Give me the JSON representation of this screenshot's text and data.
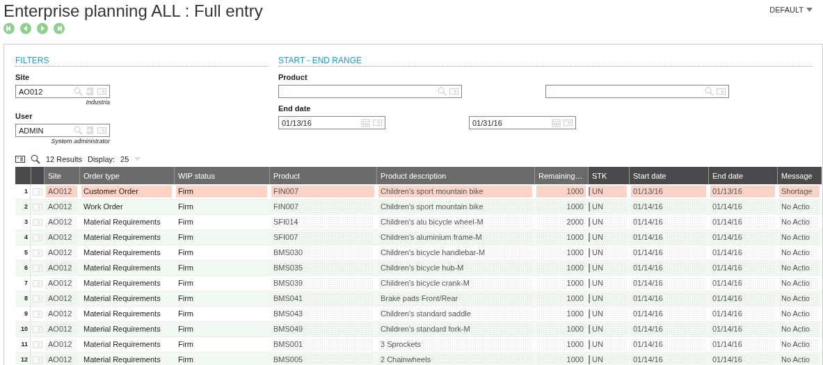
{
  "title": "Enterprise planning ALL : Full entry",
  "view_menu": "DEFAULT",
  "filters": {
    "heading": "FILTERS",
    "fields": [
      {
        "label": "Site",
        "value": "AO012",
        "caption": "Industria",
        "kind": "lookup_link"
      },
      {
        "label": "User",
        "value": "ADMIN",
        "caption": "System administrator",
        "kind": "lookup_link"
      }
    ]
  },
  "range": {
    "heading": "START - END RANGE",
    "rows": [
      {
        "label": "Product",
        "kind": "lookup",
        "from": {},
        "to": {}
      },
      {
        "label": "End date",
        "kind": "date",
        "from": {
          "value": "01/13/16"
        },
        "to": {
          "value": "01/31/16"
        }
      }
    ]
  },
  "toolbar": {
    "results": "12 Results",
    "display_label": "Display:",
    "display_value": "25"
  },
  "table": {
    "columns": [
      {
        "label": "Site",
        "readonly": true,
        "numeric": false
      },
      {
        "label": "Order type",
        "readonly": false,
        "numeric": false
      },
      {
        "label": "WIP status",
        "readonly": false,
        "numeric": false
      },
      {
        "label": "Product",
        "readonly": true,
        "numeric": false
      },
      {
        "label": "Product description",
        "readonly": true,
        "numeric": false
      },
      {
        "label": "Remaining…",
        "readonly": true,
        "numeric": true
      },
      {
        "label": "STK",
        "readonly": true,
        "numeric": false
      },
      {
        "label": "Start date",
        "readonly": true,
        "numeric": false
      },
      {
        "label": "End date",
        "readonly": true,
        "numeric": false
      },
      {
        "label": "Message",
        "readonly": true,
        "numeric": false
      }
    ],
    "rows": [
      {
        "number": "1",
        "alert": true,
        "cells": [
          "AO012",
          "Customer Order",
          "Firm",
          "FIN007",
          "Children's sport mountain bike",
          "1000",
          "UN",
          "01/13/16",
          "01/13/16",
          "Shortage"
        ]
      },
      {
        "number": "2",
        "alert": false,
        "cells": [
          "AO012",
          "Work Order",
          "Firm",
          "FIN007",
          "Children's sport mountain bike",
          "1000",
          "UN",
          "01/14/16",
          "01/14/16",
          "No Actio"
        ]
      },
      {
        "number": "3",
        "alert": false,
        "cells": [
          "AO012",
          "Material Requirements",
          "Firm",
          "SFI014",
          "Children's alu bicycle wheel-M",
          "2000",
          "UN",
          "01/14/16",
          "01/14/16",
          "No Actio"
        ]
      },
      {
        "number": "4",
        "alert": false,
        "cells": [
          "AO012",
          "Material Requirements",
          "Firm",
          "SFI007",
          "Children's aluminium frame-M",
          "1000",
          "UN",
          "01/14/16",
          "01/14/16",
          "No Actio"
        ]
      },
      {
        "number": "5",
        "alert": false,
        "cells": [
          "AO012",
          "Material Requirements",
          "Firm",
          "BMS030",
          "Children's bicycle handlebar-M",
          "1000",
          "UN",
          "01/14/16",
          "01/14/16",
          "No Actio"
        ]
      },
      {
        "number": "6",
        "alert": false,
        "cells": [
          "AO012",
          "Material Requirements",
          "Firm",
          "BMS035",
          "Children's bicycle hub-M",
          "1000",
          "UN",
          "01/14/16",
          "01/14/16",
          "No Actio"
        ]
      },
      {
        "number": "7",
        "alert": false,
        "cells": [
          "AO012",
          "Material Requirements",
          "Firm",
          "BMS039",
          "Children's bicycle crank-M",
          "1000",
          "UN",
          "01/14/16",
          "01/14/16",
          "No Actio"
        ]
      },
      {
        "number": "8",
        "alert": false,
        "cells": [
          "AO012",
          "Material Requirements",
          "Firm",
          "BMS041",
          "Brake pads Front/Rear",
          "1000",
          "UN",
          "01/14/16",
          "01/14/16",
          "No Actio"
        ]
      },
      {
        "number": "9",
        "alert": false,
        "cells": [
          "AO012",
          "Material Requirements",
          "Firm",
          "BMS043",
          "Children's standard saddle",
          "1000",
          "UN",
          "01/14/16",
          "01/14/16",
          "No Actio"
        ]
      },
      {
        "number": "10",
        "alert": false,
        "cells": [
          "AO012",
          "Material Requirements",
          "Firm",
          "BMS049",
          "Children's standard fork-M",
          "1000",
          "UN",
          "01/14/16",
          "01/14/16",
          "No Actio"
        ]
      },
      {
        "number": "11",
        "alert": false,
        "cells": [
          "AO012",
          "Material Requirements",
          "Firm",
          "BMS001",
          "3 Sprockets",
          "1000",
          "UN",
          "01/14/16",
          "01/14/16",
          "No Actio"
        ]
      },
      {
        "number": "12",
        "alert": false,
        "cells": [
          "AO012",
          "Material Requirements",
          "Firm",
          "BMS005",
          "2 Chainwheels",
          "1000",
          "UN",
          "01/14/16",
          "01/14/16",
          "No Actio"
        ]
      }
    ]
  }
}
